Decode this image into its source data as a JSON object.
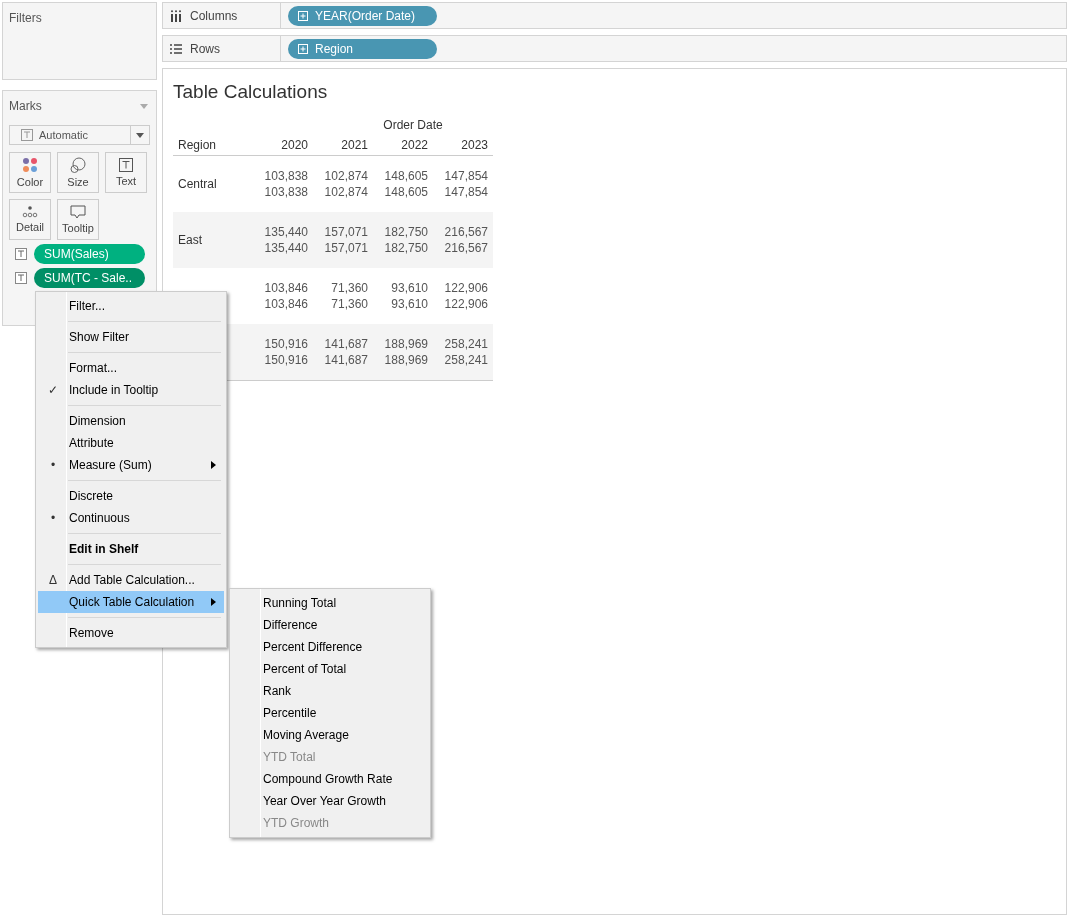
{
  "filters": {
    "title": "Filters"
  },
  "marks": {
    "title": "Marks",
    "mark_type": "Automatic",
    "cards": [
      {
        "label": "Color"
      },
      {
        "label": "Size"
      },
      {
        "label": "Text"
      },
      {
        "label": "Detail"
      },
      {
        "label": "Tooltip"
      }
    ],
    "pills": [
      {
        "label": "SUM(Sales)",
        "selected": false
      },
      {
        "label": "SUM(TC - Sale..",
        "selected": true
      }
    ]
  },
  "shelves": [
    {
      "label": "Columns",
      "kind": "columns",
      "pill": "YEAR(Order Date)"
    },
    {
      "label": "Rows",
      "kind": "rows",
      "pill": "Region"
    }
  ],
  "view": {
    "title": "Table Calculations",
    "column_group": "Order Date",
    "row_header": "Region",
    "columns": [
      "2020",
      "2021",
      "2022",
      "2023"
    ],
    "rows": [
      {
        "region": "Central",
        "values": [
          [
            "103,838",
            "102,874",
            "148,605",
            "147,854"
          ],
          [
            "103,838",
            "102,874",
            "148,605",
            "147,854"
          ]
        ]
      },
      {
        "region": "East",
        "values": [
          [
            "135,440",
            "157,071",
            "182,750",
            "216,567"
          ],
          [
            "135,440",
            "157,071",
            "182,750",
            "216,567"
          ]
        ]
      },
      {
        "values": [
          [
            "103,846",
            "71,360",
            "93,610",
            "122,906"
          ],
          [
            "103,846",
            "71,360",
            "93,610",
            "122,906"
          ]
        ]
      },
      {
        "values": [
          [
            "150,916",
            "141,687",
            "188,969",
            "258,241"
          ],
          [
            "150,916",
            "141,687",
            "188,969",
            "258,241"
          ]
        ]
      }
    ]
  },
  "context_menu": {
    "groups": [
      [
        {
          "label": "Filter...",
          "selected": false
        }
      ],
      [
        {
          "label": "Show Filter",
          "selected": false
        }
      ],
      [
        {
          "label": "Format...",
          "selected": false
        },
        {
          "label": "Include in Tooltip",
          "selected": false,
          "mark": "✓"
        }
      ],
      [
        {
          "label": "Dimension",
          "selected": false
        },
        {
          "label": "Attribute",
          "selected": false
        },
        {
          "label": "Measure (Sum)",
          "selected": false,
          "mark": "•",
          "submenu": true
        }
      ],
      [
        {
          "label": "Discrete",
          "selected": false
        },
        {
          "label": "Continuous",
          "selected": false,
          "mark": "•"
        }
      ],
      [
        {
          "label": "Edit in Shelf",
          "selected": false,
          "bold": true
        }
      ],
      [
        {
          "label": "Add Table Calculation...",
          "selected": false,
          "mark": "Δ"
        },
        {
          "label": "Quick Table Calculation",
          "selected": true,
          "submenu": true
        }
      ],
      [
        {
          "label": "Remove",
          "selected": false
        }
      ]
    ]
  },
  "submenu": {
    "items": [
      {
        "label": "Running Total",
        "disabled": false
      },
      {
        "label": "Difference",
        "disabled": false
      },
      {
        "label": "Percent Difference",
        "disabled": false
      },
      {
        "label": "Percent of Total",
        "disabled": false
      },
      {
        "label": "Rank",
        "disabled": false
      },
      {
        "label": "Percentile",
        "disabled": false
      },
      {
        "label": "Moving Average",
        "disabled": false
      },
      {
        "label": "YTD Total",
        "disabled": true
      },
      {
        "label": "Compound Growth Rate",
        "disabled": false
      },
      {
        "label": "Year Over Year Growth",
        "disabled": false
      },
      {
        "label": "YTD Growth",
        "disabled": true
      }
    ]
  }
}
